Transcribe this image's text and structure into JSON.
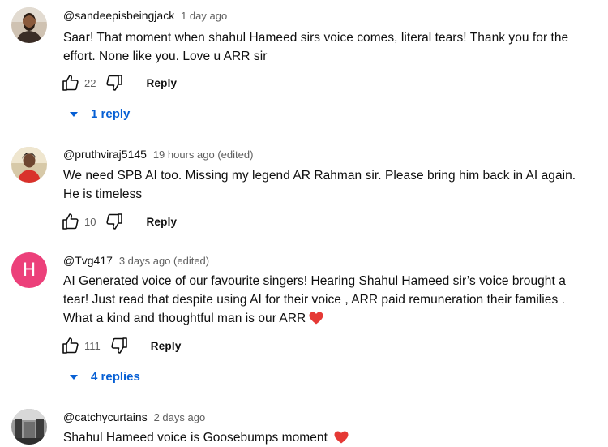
{
  "comments": [
    {
      "author": "@sandeepisbeingjack",
      "time": "1 day ago",
      "text": "Saar! That moment when shahul Hameed sirs voice comes, literal tears! Thank you for the effort. None like you. Love u ARR sir",
      "likes": "22",
      "reply_label": "Reply",
      "replies_label": "1 reply",
      "avatar": "photo"
    },
    {
      "author": "@pruthviraj5145",
      "time": "19 hours ago (edited)",
      "text": "We need SPB AI too. Missing my legend AR Rahman sir. Please bring him back in AI again. He is timeless",
      "likes": "10",
      "reply_label": "Reply",
      "avatar": "photo"
    },
    {
      "author": "@Tvg417",
      "time": "3 days ago (edited)",
      "text": "AI Generated voice of our favourite singers! Hearing Shahul Hameed sir’s voice brought a tear! Just read that despite using AI for their voice , ARR paid remuneration their families . What a kind and thoughtful man is our ARR",
      "likes": "111",
      "reply_label": "Reply",
      "replies_label": "4 replies",
      "avatar_letter": "H",
      "avatar_color": "#ec407a"
    },
    {
      "author": "@catchycurtains",
      "time": "2 days ago",
      "text": "Shahul Hameed voice is Goosebumps moment",
      "avatar": "photo"
    }
  ],
  "colors": {
    "link": "#065fd4",
    "meta": "#606060",
    "heart": "#e53935"
  },
  "icons": [
    "like-icon",
    "dislike-icon",
    "chevron-down-icon",
    "heart-emoji-icon"
  ]
}
